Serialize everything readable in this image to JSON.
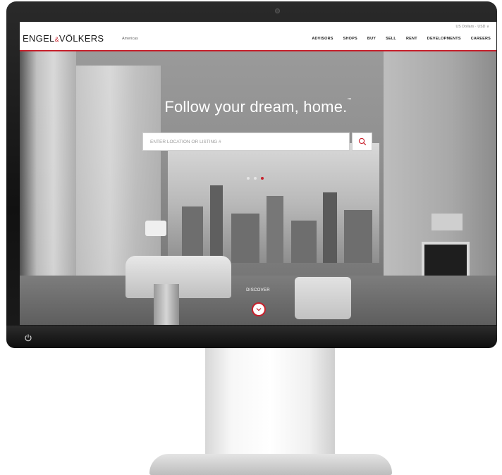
{
  "header": {
    "topbar_text": "US Dollars · USD ∨",
    "logo_text": "ENGEL",
    "logo_amp": "&",
    "logo_text2": "VÖLKERS",
    "logo_sub": "Americas",
    "nav": [
      "ADVISORS",
      "SHOPS",
      "BUY",
      "SELL",
      "RENT",
      "DEVELOPMENTS",
      "CAREERS"
    ]
  },
  "hero": {
    "headline": "Follow your dream, home.",
    "headline_mark": "™",
    "search_placeholder": "ENTER LOCATION OR LISTING #",
    "discover_label": "DISCOVER",
    "carousel_active_index": 2
  },
  "colors": {
    "brand_red": "#c7202b"
  },
  "icons": {
    "search": "search-icon",
    "discover": "chevron-down-icon",
    "power": "power-icon"
  }
}
